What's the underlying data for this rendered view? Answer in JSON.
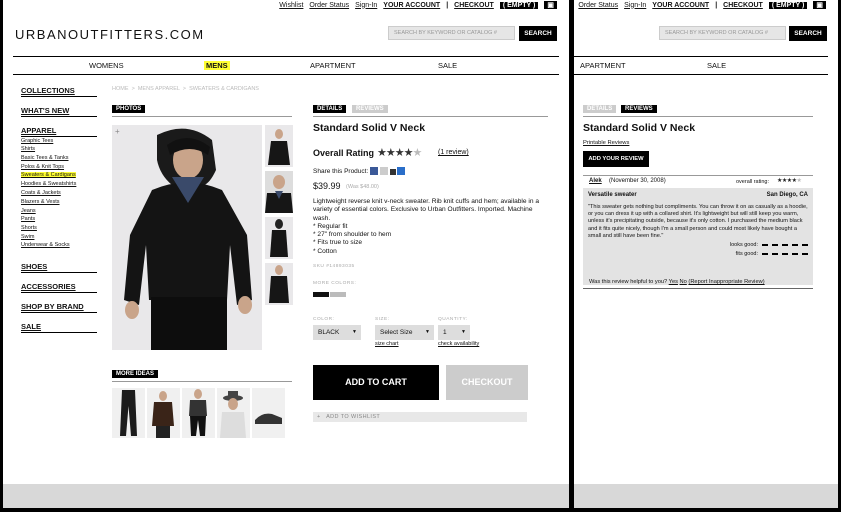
{
  "toplinks": {
    "wishlist": "Wishlist",
    "order_status": "Order Status",
    "sign_in": "Sign-In",
    "your_account": "YOUR ACCOUNT",
    "sep": "|",
    "checkout": "CHECKOUT",
    "bag": "( EMPTY )",
    "bag_icon": "▣"
  },
  "logo": "URBANOUTFITTERS.COM",
  "search": {
    "placeholder": "SEARCH BY KEYWORD OR CATALOG #",
    "button": "SEARCH"
  },
  "nav": {
    "womens": "WOMENS",
    "mens": "MENS",
    "apartment": "APARTMENT",
    "sale": "SALE"
  },
  "sidebar": {
    "collections": "COLLECTIONS",
    "whats_new": "WHAT'S NEW",
    "apparel": "APPAREL",
    "sub": [
      "Graphic Tees",
      "Shirts",
      "Basic Tees & Tanks",
      "Polos & Knit Tops",
      "Sweaters & Cardigans",
      "Hoodies & Sweatshirts",
      "Coats & Jackets",
      "Blazers & Vests",
      "Jeans",
      "Pants",
      "Shorts",
      "Swim",
      "Underwear & Socks"
    ],
    "shoes": "SHOES",
    "accessories": "ACCESSORIES",
    "shop_by_brand": "SHOP BY BRAND",
    "sale": "SALE"
  },
  "breadcrumb": {
    "home": "HOME",
    "sep": ">",
    "mens_apparel": "MENS APPAREL",
    "current": "SWEATERS & CARDIGANS"
  },
  "photos_tab": "PHOTOS",
  "zoom_icon": "+",
  "more_ideas": "MORE IDEAS",
  "tabs": {
    "details": "DETAILS",
    "reviews": "REVIEWS"
  },
  "product": {
    "title": "Standard Solid V Neck",
    "rating_label": "Overall Rating",
    "stars": "★★★★★",
    "rating": 4,
    "reviews_link": "(1 review)",
    "share_label": "Share this Product:",
    "price": "$39.99",
    "was_price": "(Was $48.00)",
    "description": "Lightweight reverse knit v-neck sweater. Rib knit cuffs and hem; available in a variety of essential colors. Exclusive to Urban Outfitters. Imported. Machine wash.",
    "bullets": [
      "* Regular fit",
      "* 27\" from shoulder to hem",
      "* Fits true to size",
      "* Cotton"
    ],
    "sku": "SKU #14893035",
    "more_colors": "MORE COLORS:",
    "color_label": "COLOR:",
    "color_value": "BLACK",
    "size_label": "SIZE:",
    "size_value": "Select Size",
    "qty_label": "QUANTITY:",
    "qty_value": "1",
    "chev": "▼",
    "size_chart": "size chart",
    "check_availability": "check availability",
    "add_to_cart": "ADD TO CART",
    "checkout": "CHECKOUT",
    "wishlist_plus": "+",
    "add_to_wishlist": "ADD TO WISHLIST"
  },
  "reviews": {
    "printable": "Printable Reviews",
    "add_review": "ADD YOUR REVIEW",
    "author": "Alek",
    "date": "(November 30, 2008)",
    "overall_label": "overall rating:",
    "overall_stars": "★★★★★",
    "overall_rating": 4,
    "headline": "Versatile sweater",
    "location": "San Diego, CA",
    "body": "\"This sweater gets nothing but compliments. You can throw it on as casually as a hoodie, or you can dress it up with a collared shirt. It's lightweight but will still keep you warm, unless it's precipitating outside, because it's only cotton. I purchased the medium black and it fits quite nicely, though I'm a small person and could most likely have bought a small and still have been fine.\"",
    "looks_good": "looks good:",
    "fits_good": "fits good:",
    "helpful": "Was this review helpful to you?",
    "yes": "Yes",
    "no": "No",
    "report": "(Report Inappropriate Review)"
  }
}
